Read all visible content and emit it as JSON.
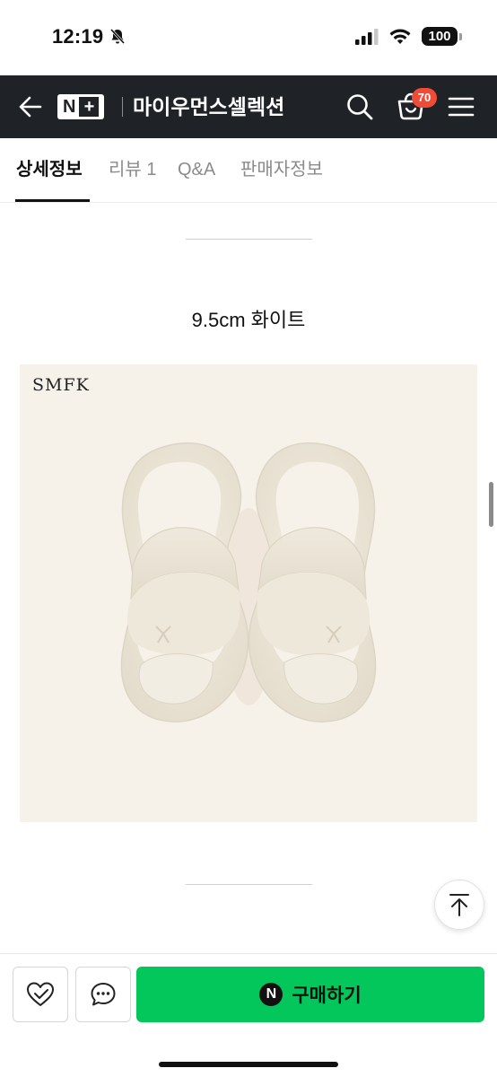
{
  "status_bar": {
    "time": "12:19",
    "battery": "100",
    "icons": [
      "mute-bell-icon",
      "cellular-signal-icon",
      "wifi-icon",
      "battery-icon"
    ]
  },
  "nav": {
    "logo_text": "N",
    "logo_plus": "+",
    "store_name": "마이우먼스셀렉션",
    "cart_count": "70",
    "icons": [
      "back-arrow-icon",
      "search-icon",
      "cart-icon",
      "menu-icon"
    ]
  },
  "tabs": [
    {
      "label": "상세정보",
      "active": true
    },
    {
      "label": "리뷰 1",
      "active": false
    },
    {
      "label": "Q&A",
      "active": false
    },
    {
      "label": "판매자정보",
      "active": false
    }
  ],
  "content": {
    "option_title": "9.5cm 화이트",
    "image_brand": "SMFK"
  },
  "bottom_bar": {
    "buy_badge": "N",
    "buy_label": "구매하기",
    "icons": [
      "zzim-heart-check-icon",
      "chat-bubble-icon",
      "scroll-to-top-icon"
    ]
  },
  "colors": {
    "nav_bg": "#1f2226",
    "badge": "#f04b37",
    "buy_green": "#03c75a",
    "image_bg": "#f6f2ea"
  }
}
